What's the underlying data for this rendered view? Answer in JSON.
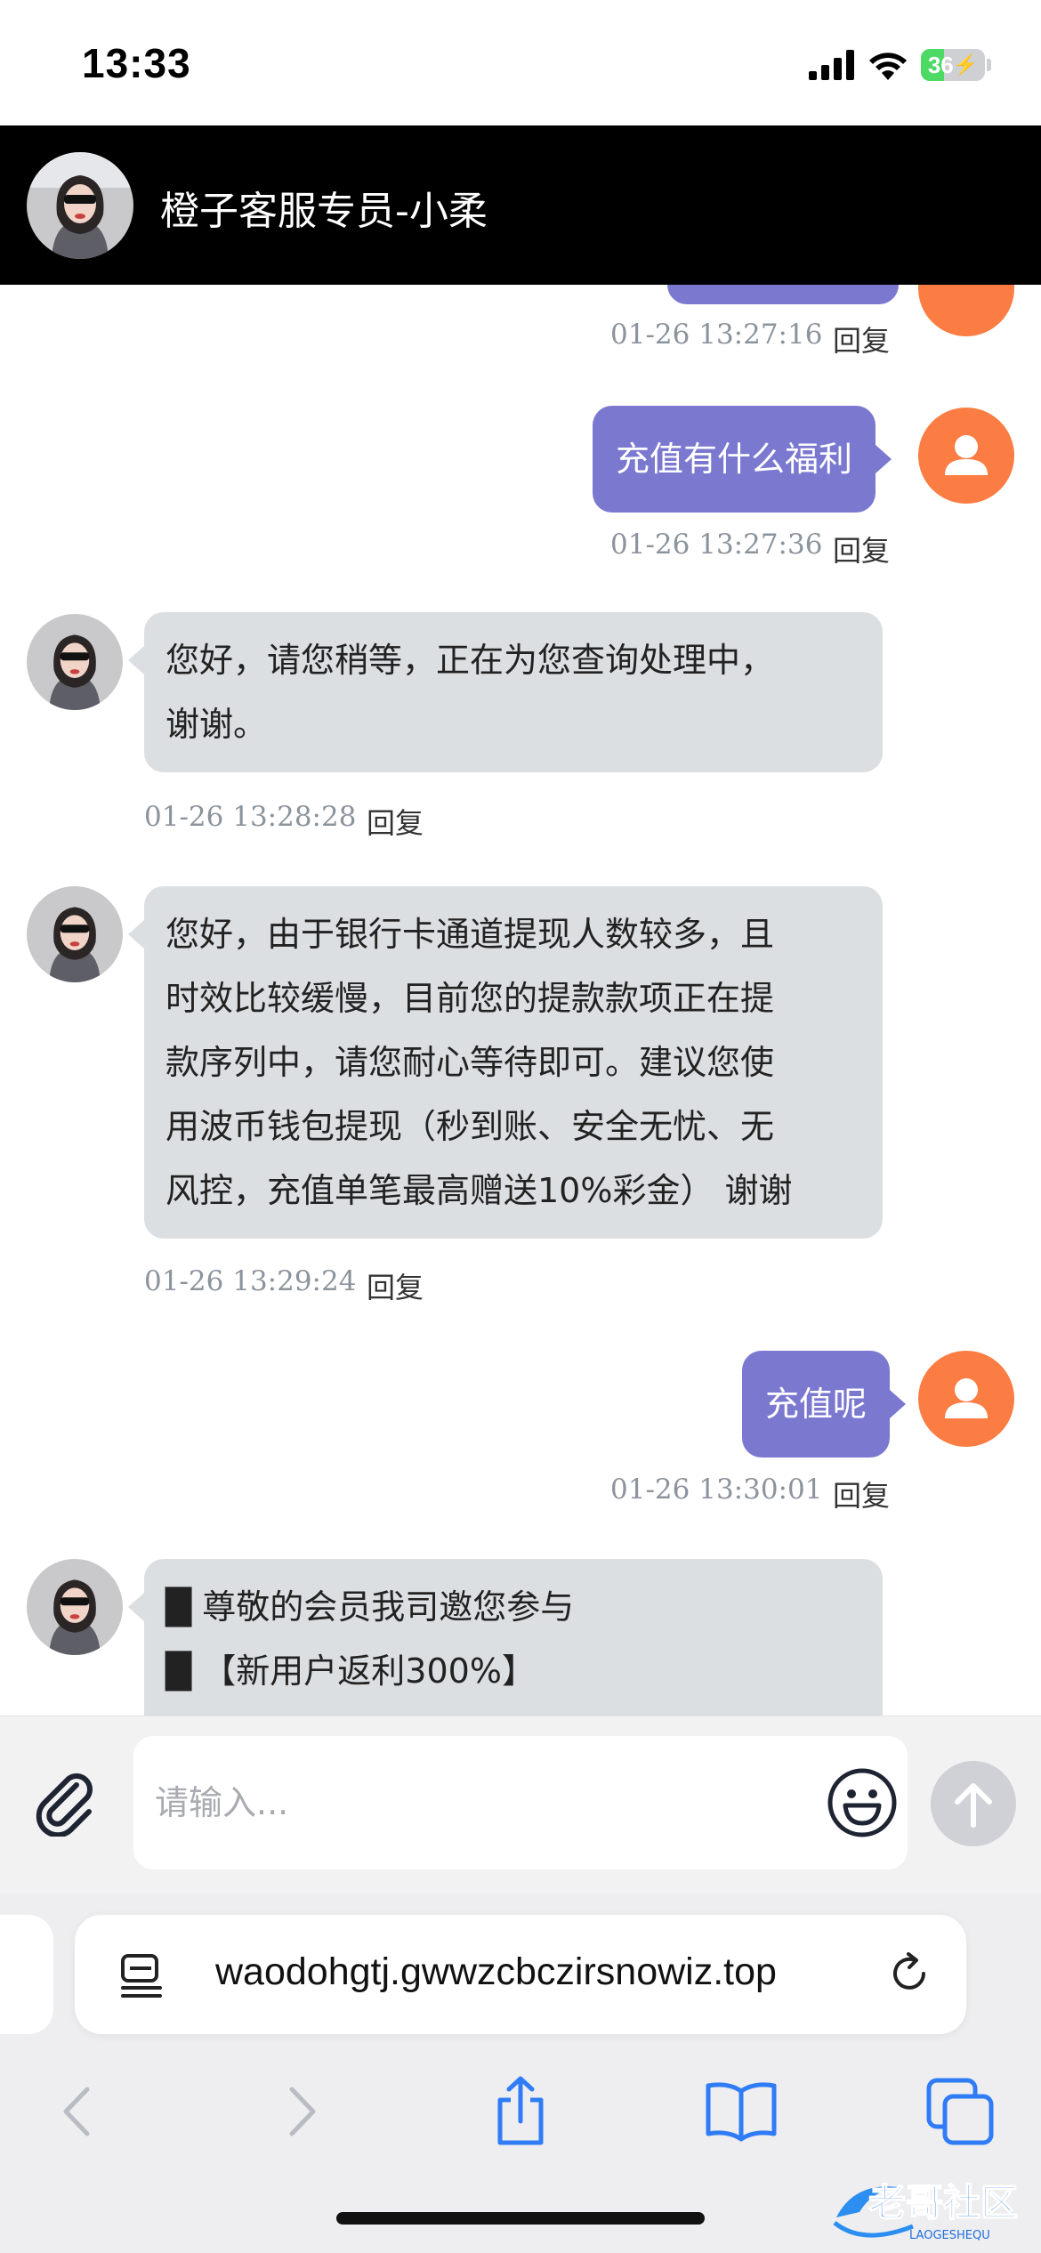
{
  "status_bar": {
    "time": "13:33",
    "battery": "36",
    "battery_level": 0.36
  },
  "header": {
    "title": "橙子客服专员-小柔"
  },
  "messages": [
    {
      "side": "user",
      "text": "充值有什么福利",
      "time": "01-26 13:27:36",
      "reply": "回复"
    },
    {
      "side": "agent",
      "lines": [
        "您好，请您稍等，正在为您查询处理中，",
        "谢谢。"
      ],
      "time": "01-26 13:28:28",
      "reply": "回复"
    },
    {
      "side": "agent",
      "lines": [
        "您好，由于银行卡通道提现人数较多，且",
        "时效比较缓慢，目前您的提款款项正在提",
        "款序列中，请您耐心等待即可。建议您使",
        "用波币钱包提现（秒到账、安全无忧、无",
        "风控，充值单笔最高赠送10%彩金） 谢谢"
      ],
      "time": "01-26 13:29:24",
      "reply": "回复"
    },
    {
      "side": "user",
      "text": "充值呢",
      "time": "01-26 13:30:01",
      "reply": "回复"
    },
    {
      "side": "agent",
      "lines": [
        "█ 尊敬的会员我司邀您参与",
        "█ 【新用户返利300%】"
      ]
    }
  ],
  "previous_message": {
    "time": "01-26 13:27:16",
    "reply": "回复"
  },
  "input": {
    "placeholder": "请输入..."
  },
  "browser": {
    "url": "waodohgtj.gwwzcbczirsnowiz.top"
  },
  "watermark": {
    "text": "老哥社区",
    "sub": "LAOGESHEQU"
  },
  "colors": {
    "user_bubble": "#7b78d0",
    "agent_bubble": "#dcdfe1",
    "user_avatar": "#fb7d44",
    "header": "#000000"
  }
}
